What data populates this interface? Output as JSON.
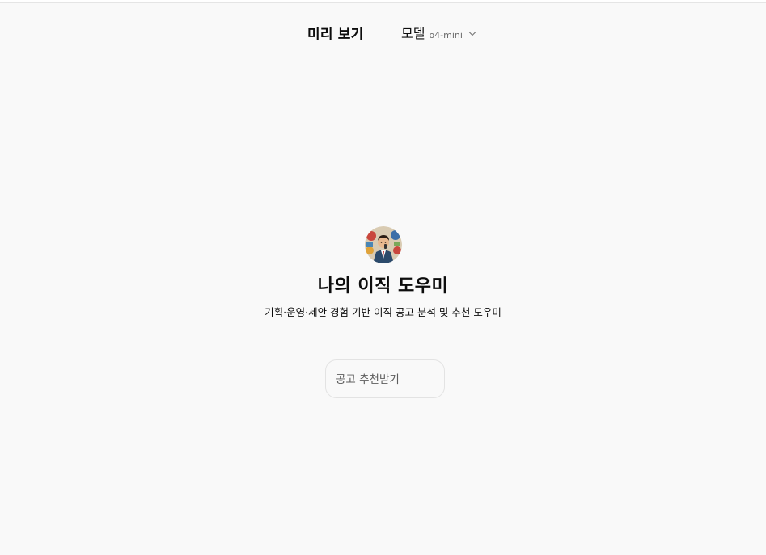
{
  "header": {
    "title": "미리 보기",
    "model_label": "모델",
    "model_value": "o4-mini",
    "dropdown_icon": "chevron-down-icon"
  },
  "gpt": {
    "avatar_icon": "avatar-illustration",
    "name": "나의 이직 도우미",
    "description": "기획·운영·제안 경험 기반 이직 공고 분석 및 추천 도우미"
  },
  "starters": [
    {
      "label": "공고 추천받기"
    }
  ]
}
